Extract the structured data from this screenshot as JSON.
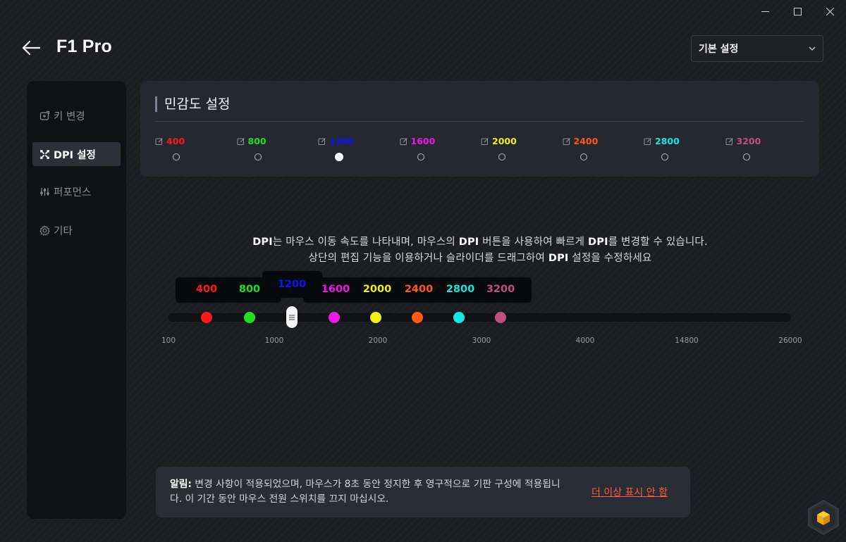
{
  "window": {
    "controls": [
      {
        "name": "minimize-button",
        "glyph": "—"
      },
      {
        "name": "maximize-button",
        "glyph": "☐"
      },
      {
        "name": "close-button",
        "glyph": "✕"
      }
    ]
  },
  "header": {
    "title": "F1 Pro",
    "preset_value": "기본 설정"
  },
  "sidebar": {
    "items": [
      {
        "label": "키 변경",
        "icon": "key-remap-icon"
      },
      {
        "label": "DPI 설정",
        "icon": "dpi-icon",
        "active": true
      },
      {
        "label": "퍼포먼스",
        "icon": "performance-sliders-icon"
      },
      {
        "label": "기타",
        "icon": "gear-icon"
      }
    ]
  },
  "sensitivity": {
    "title": "민감도 설정",
    "selected_index": 2,
    "levels": [
      {
        "label": "400",
        "color": "#ff1a1a"
      },
      {
        "label": "800",
        "color": "#22e01e"
      },
      {
        "label": "1200",
        "color": "#1010ff"
      },
      {
        "label": "1600",
        "color": "#ee16e8"
      },
      {
        "label": "2000",
        "color": "#f0f016"
      },
      {
        "label": "2400",
        "color": "#ff5a14"
      },
      {
        "label": "2800",
        "color": "#14e8e0"
      },
      {
        "label": "3200",
        "color": "#c2507e"
      }
    ]
  },
  "description": {
    "line1_parts": [
      "DPI",
      "는 마우스 이동 속도를 나타내며, 마우스의 ",
      "DPI",
      " 버튼을 사용하여 빠르게 ",
      "DPI",
      "를 변경할 수 있습니다."
    ],
    "line2_parts": [
      "상단의 편집 기능을 이용하거나 슬라이더를 드래그하여 ",
      "DPI",
      " 설정을 수정하세요"
    ]
  },
  "slider": {
    "tick_labels": [
      "100",
      "1000",
      "2000",
      "3000",
      "4000",
      "14800",
      "26000"
    ],
    "bubble_labels": [
      "400",
      "800",
      "1200",
      "1600",
      "2000",
      "2400",
      "2800",
      "3200"
    ]
  },
  "notice": {
    "bold": "알림:",
    "text": " 변경 사항이 적용되었으며, 마우스가 8초 동안 정지한 후 영구적으로 기판 구성에 적용됩니다. 이 기간 동안 마우스 전원 스위치를 끄지 마십시오.",
    "dismiss": "더 이상 표시 안 함"
  }
}
